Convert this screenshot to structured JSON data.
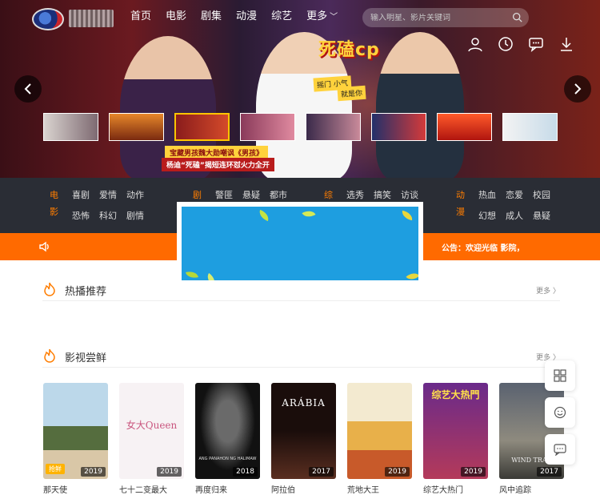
{
  "header": {
    "nav": [
      "首页",
      "电影",
      "剧集",
      "动漫",
      "综艺",
      "更多"
    ],
    "search_placeholder": "输入明星、影片关键词"
  },
  "hero": {
    "title_badge": "死磕cp",
    "side_label_1": "摇门 小气",
    "side_label_2": "就是你",
    "tag_1": "宝藏男孩魏大勋嘲讽《男孩》",
    "tag_2": "杨迪“死磕”揭短连环怼火力全开"
  },
  "categories": [
    {
      "head": [
        "电",
        "影"
      ],
      "items": [
        "喜剧",
        "爱情",
        "动作",
        "恐怖",
        "科幻",
        "剧情"
      ],
      "color": "#ff7d00"
    },
    {
      "head": [
        "剧",
        ""
      ],
      "items": [
        "警匪",
        "悬疑",
        "都市",
        "",
        "",
        ""
      ],
      "color": "#ff7d00"
    },
    {
      "head": [
        "综",
        ""
      ],
      "items": [
        "选秀",
        "搞笑",
        "访谈",
        "",
        "",
        ""
      ],
      "color": "#ff7d00"
    },
    {
      "head": [
        "动",
        "漫"
      ],
      "items": [
        "热血",
        "恋爱",
        "校园",
        "幻想",
        "成人",
        "悬疑"
      ],
      "color": "#ff7d00"
    }
  ],
  "notice": {
    "text": "公告：欢迎光临                  影院，"
  },
  "sections": [
    {
      "title": "热播推荐",
      "more": "更多 〉"
    },
    {
      "title": "影视尝鲜",
      "more": "更多 〉"
    }
  ],
  "posters": [
    {
      "year": "2019",
      "badge": "抢鲜",
      "caption": "那天使",
      "title": "",
      "bg": "#8fb6cf"
    },
    {
      "year": "2019",
      "badge": "",
      "caption": "七十二变最大",
      "title": "女大Queen",
      "bg": "#f7f2f4"
    },
    {
      "year": "2018",
      "badge": "",
      "caption": "再度归来",
      "title": "ANG PANAHON NG HALIMAW",
      "bg": "#151515"
    },
    {
      "year": "2017",
      "badge": "",
      "caption": "阿拉伯",
      "title": "ARÁBIA",
      "bg": "#2a1512"
    },
    {
      "year": "2019",
      "badge": "",
      "caption": "荒地大王",
      "title": "",
      "bg": "#e8d28a"
    },
    {
      "year": "2019",
      "badge": "",
      "caption": "综艺大热门",
      "title": "综艺大热門",
      "bg": "#4a1a6a"
    },
    {
      "year": "2017",
      "badge": "",
      "caption": "风中追踪",
      "title": "WIND TRAC",
      "bg": "#4e5660"
    }
  ],
  "colors": {
    "accent": "#ff6a00",
    "category_bar": "#2a2d35",
    "category_head": "#ff7d00"
  },
  "tools": [
    "qr-code-icon",
    "smile-icon",
    "message-icon"
  ]
}
